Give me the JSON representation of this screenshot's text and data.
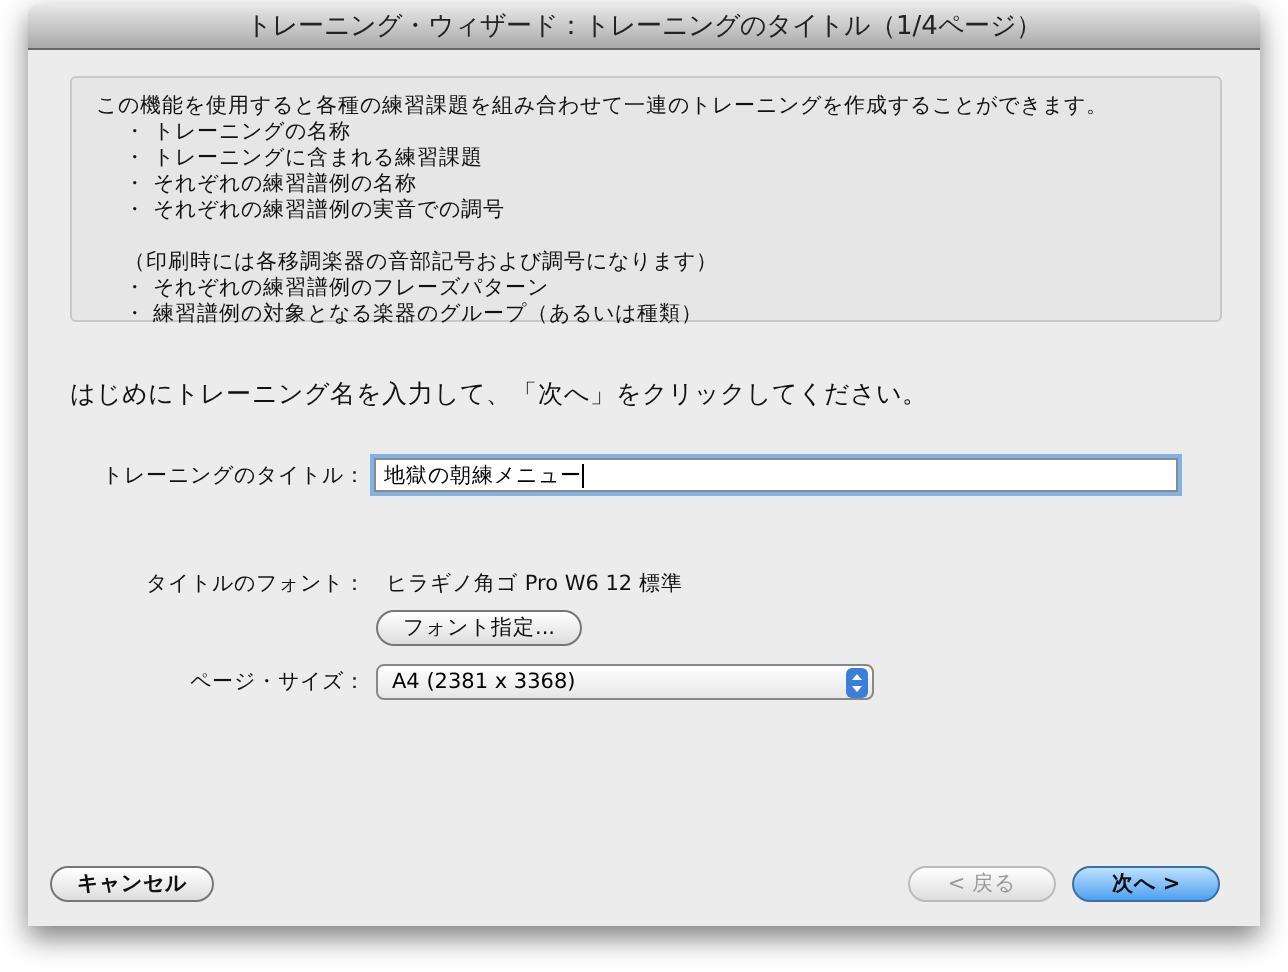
{
  "window": {
    "title": "トレーニング・ウィザード：トレーニングのタイトル（1/4ページ）"
  },
  "info": [
    {
      "kind": "intro",
      "text": "この機能を使用すると各種の練習課題を組み合わせて一連のトレーニングを作成することができます。"
    },
    {
      "kind": "bullet",
      "text": "・ トレーニングの名称"
    },
    {
      "kind": "bullet",
      "text": "・ トレーニングに含まれる練習課題"
    },
    {
      "kind": "bullet",
      "text": "・ それぞれの練習譜例の名称"
    },
    {
      "kind": "bullet",
      "text": "・ それぞれの練習譜例の実音での調号"
    },
    {
      "kind": "note",
      "text": "（印刷時には各移調楽器の音部記号および調号になります）"
    },
    {
      "kind": "bullet",
      "text": "・ それぞれの練習譜例のフレーズパターン"
    },
    {
      "kind": "bullet",
      "text": "・ 練習譜例の対象となる楽器のグループ（あるいは種類）"
    }
  ],
  "instruction": "はじめにトレーニング名を入力して、「次へ」をクリックしてください。",
  "title_field": {
    "label": "トレーニングのタイトル：",
    "value": "地獄の朝練メニュー",
    "focused": true
  },
  "font": {
    "label": "タイトルのフォント：",
    "value": "ヒラギノ角ゴ Pro W6 12 標準",
    "button": "フォント指定..."
  },
  "page_size": {
    "label": "ページ・サイズ：",
    "value": "A4 (2381 x 3368)"
  },
  "buttons": [
    {
      "label": "キャンセル",
      "kind": "cancel",
      "disabled": false,
      "default": false
    },
    {
      "label": "< 戻る",
      "kind": "back",
      "disabled": true,
      "default": false
    },
    {
      "label": "次へ >",
      "kind": "next",
      "disabled": false,
      "default": true
    }
  ]
}
